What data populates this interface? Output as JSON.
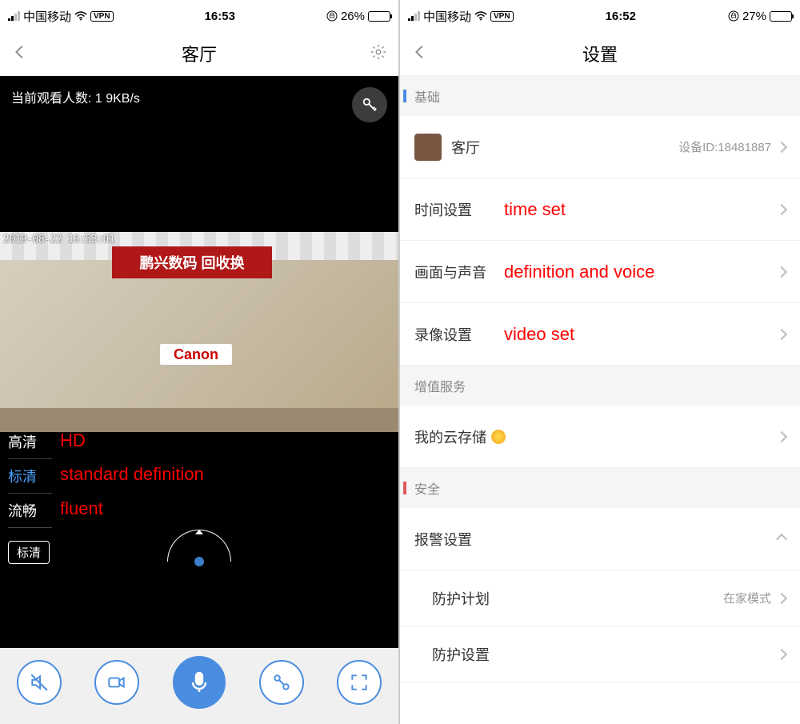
{
  "left": {
    "status": {
      "carrier": "中国移动",
      "vpn": "VPN",
      "time": "16:53",
      "battery_pct": "26%"
    },
    "nav": {
      "title": "客厅"
    },
    "viewers_label": "当前观看人数: 1  9KB/s",
    "video": {
      "timestamp": "2019-08-22  16:53:01",
      "sign_text": "鹏兴数码 回收换",
      "canon": "Canon"
    },
    "quality": {
      "hd": "高清",
      "sd": "标清",
      "fluent": "流畅",
      "selected": "标清"
    },
    "annotations": {
      "hd": "HD",
      "sd": "standard definition",
      "fluent": "fluent"
    }
  },
  "right": {
    "status": {
      "carrier": "中国移动",
      "vpn": "VPN",
      "time": "16:52",
      "battery_pct": "27%"
    },
    "nav": {
      "title": "设置"
    },
    "sections": {
      "basic": "基础",
      "value_added": "增值服务",
      "security": "安全"
    },
    "rows": {
      "device_name": "客厅",
      "device_id_label": "设备ID:18481887",
      "time_set": "时间设置",
      "av": "画面与声音",
      "record": "录像设置",
      "cloud": "我的云存储",
      "alarm": "报警设置",
      "plan": "防护计划",
      "plan_value": "在家模式",
      "protect": "防护设置"
    },
    "annotations": {
      "time": "time set",
      "av": "definition and voice",
      "record": "video set"
    }
  }
}
